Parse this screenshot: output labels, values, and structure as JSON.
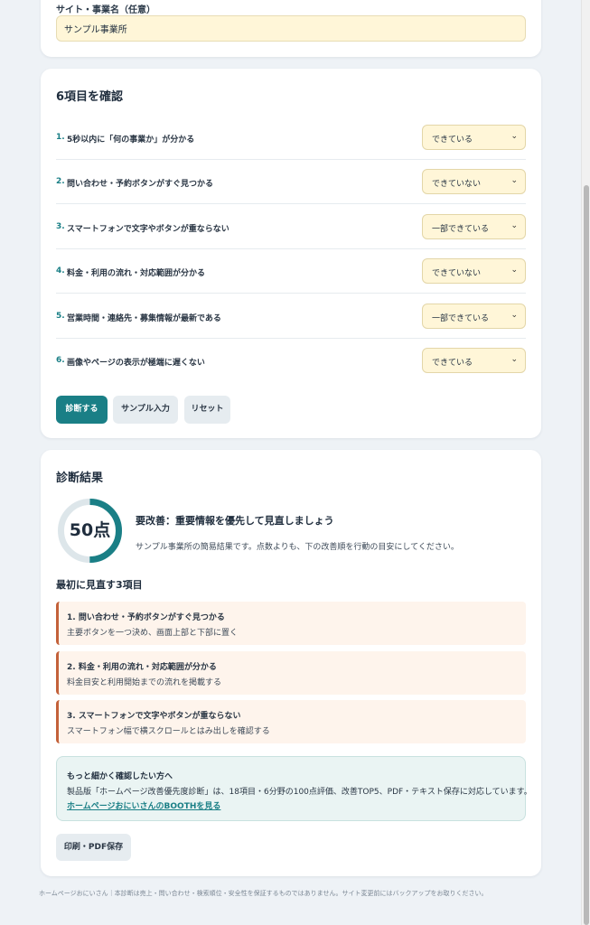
{
  "site_field": {
    "label": "サイト・事業名（任意）",
    "value": "サンプル事業所"
  },
  "checklist": {
    "title": "6項目を確認",
    "items": [
      {
        "num": "1.",
        "text": "5秒以内に「何の事業か」が分かる",
        "selected": "できている"
      },
      {
        "num": "2.",
        "text": "問い合わせ・予約ボタンがすぐ見つかる",
        "selected": "できていない"
      },
      {
        "num": "3.",
        "text": "スマートフォンで文字やボタンが重ならない",
        "selected": "一部できている"
      },
      {
        "num": "4.",
        "text": "料金・利用の流れ・対応範囲が分かる",
        "selected": "できていない"
      },
      {
        "num": "5.",
        "text": "営業時間・連絡先・募集情報が最新である",
        "selected": "一部できている"
      },
      {
        "num": "6.",
        "text": "画像やページの表示が極端に遅くない",
        "selected": "できている"
      }
    ],
    "buttons": {
      "diagnose": "診断する",
      "sample": "サンプル入力",
      "reset": "リセット"
    }
  },
  "result": {
    "title": "診断結果",
    "score_text": "50点",
    "score_fraction": 0.5,
    "verdict": "要改善：重要情報を優先して見直しましょう",
    "description": "サンプル事業所の簡易結果です。点数よりも、下の改善順を行動の目安にしてください。",
    "priority_title": "最初に見直す3項目",
    "priorities": [
      {
        "title": "1. 問い合わせ・予約ボタンがすぐ見つかる",
        "desc": "主要ボタンを一つ決め、画面上部と下部に置く"
      },
      {
        "title": "2. 料金・利用の流れ・対応範囲が分かる",
        "desc": "料金目安と利用開始までの流れを掲載する"
      },
      {
        "title": "3. スマートフォンで文字やボタンが重ならない",
        "desc": "スマートフォン幅で横スクロールとはみ出しを確認する"
      }
    ],
    "promo": {
      "title": "もっと細かく確認したい方へ",
      "desc": "製品版「ホームページ改善優先度診断」は、18項目・6分野の100点評価、改善TOP5、PDF・テキスト保存に対応しています。",
      "link": "ホームページおにいさんのBOOTHを見る"
    },
    "print_button": "印刷・PDF保存"
  },
  "footer": "ホームページおにいさん｜本診断は売上・問い合わせ・検索順位・安全性を保証するものではありません。サイト変更前にはバックアップをお取りください。",
  "colors": {
    "accent": "#1a7f86",
    "select_bg": "#fff6d8",
    "priority_border": "#c3613a",
    "priority_bg": "#fef4ec"
  }
}
